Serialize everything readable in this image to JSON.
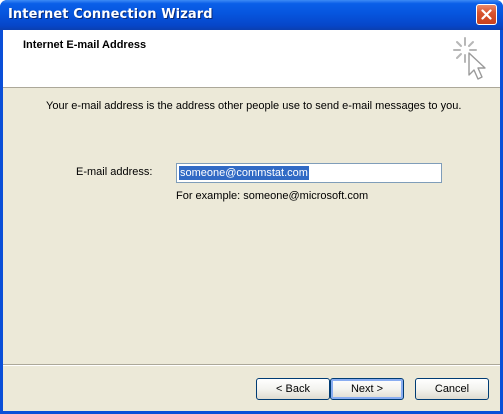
{
  "window": {
    "title": "Internet Connection Wizard"
  },
  "header": {
    "title": "Internet E-mail Address",
    "icon": "wizard-wand-icon"
  },
  "main": {
    "description": "Your e-mail address is the address other people use to send e-mail messages to you.",
    "email_label": "E-mail address:",
    "email_value": "someone@commstat.com",
    "example": "For example: someone@microsoft.com"
  },
  "buttons": {
    "back": "< Back",
    "next": "Next >",
    "cancel": "Cancel"
  },
  "colors": {
    "titlebar": "#0655de",
    "client_bg": "#ece9d8",
    "selection": "#316ac5",
    "close_button": "#d8542f"
  }
}
